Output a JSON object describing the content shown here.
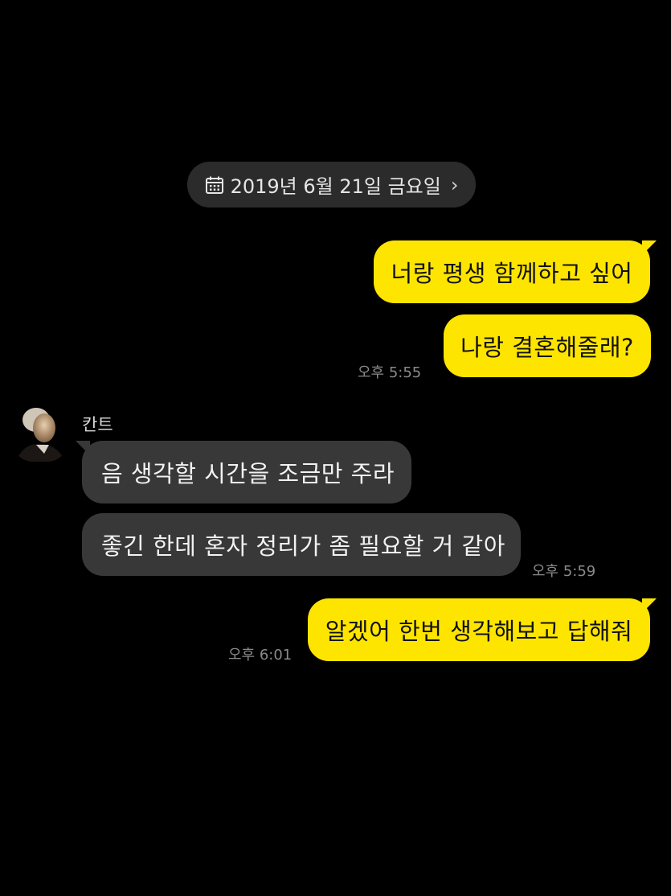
{
  "date_divider": {
    "label": "2019년 6월 21일 금요일",
    "icon": "calendar-icon",
    "chevron": "chevron-right-icon"
  },
  "messages": [
    {
      "from": "me",
      "text": "너랑 평생 함께하고 싶어"
    },
    {
      "from": "me",
      "text": "나랑 결혼해줄래?",
      "time": "오후 5:55"
    },
    {
      "from": "contact",
      "sender": "칸트",
      "text": "음 생각할 시간을 조금만 주라"
    },
    {
      "from": "contact",
      "text": "좋긴 한데 혼자 정리가 좀 필요할 거 같아",
      "time": "오후 5:59"
    },
    {
      "from": "me",
      "text": "알겠어 한번 생각해보고 답해줘",
      "time": "오후 6:01"
    }
  ],
  "colors": {
    "background": "#000000",
    "my_bubble": "#fee500",
    "their_bubble": "#383838",
    "date_pill": "#2b2b2b",
    "timestamp": "#8a8a8a"
  }
}
